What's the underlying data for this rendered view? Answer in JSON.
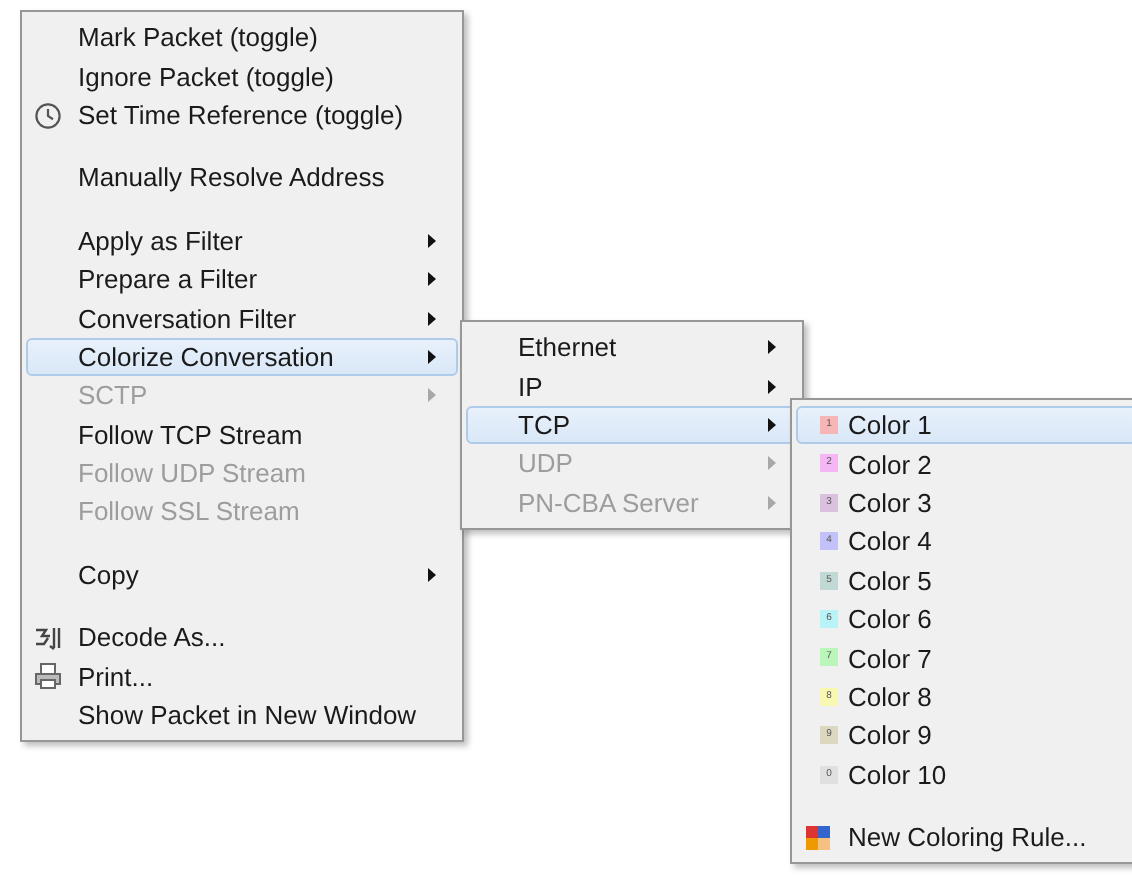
{
  "menus": [
    {
      "items": [
        {
          "kind": "text",
          "label": "Mark Packet (toggle)",
          "disabled": false,
          "selected": false
        },
        {
          "kind": "text",
          "label": "Ignore Packet (toggle)",
          "disabled": false,
          "selected": false
        },
        {
          "kind": "icon",
          "label": "Set Time Reference (toggle)",
          "disabled": false,
          "selected": false
        },
        {
          "kind": "separator"
        },
        {
          "kind": "text",
          "label": "Manually Resolve Address",
          "disabled": false,
          "selected": false
        },
        {
          "kind": "separator"
        },
        {
          "kind": "submenu",
          "label": "Apply as Filter",
          "disabled": false,
          "selected": false
        },
        {
          "kind": "submenu",
          "label": "Prepare a Filter",
          "disabled": false,
          "selected": false
        },
        {
          "kind": "submenu",
          "label": "Conversation Filter",
          "disabled": false,
          "selected": false
        },
        {
          "kind": "submenu",
          "label": "Colorize Conversation",
          "disabled": false,
          "selected": true
        },
        {
          "kind": "submenu",
          "label": "SCTP",
          "disabled": true,
          "selected": false
        },
        {
          "kind": "text",
          "label": "Follow TCP Stream",
          "disabled": false,
          "selected": false
        },
        {
          "kind": "text",
          "label": "Follow UDP Stream",
          "disabled": true,
          "selected": false
        },
        {
          "kind": "text",
          "label": "Follow SSL Stream",
          "disabled": true,
          "selected": false
        },
        {
          "kind": "separator"
        },
        {
          "kind": "submenu",
          "label": "Copy",
          "disabled": false,
          "selected": false
        },
        {
          "kind": "separator"
        },
        {
          "kind": "icon",
          "label": "Decode As...",
          "disabled": false,
          "selected": false
        },
        {
          "kind": "icon",
          "label": "Print...",
          "disabled": false,
          "selected": false
        },
        {
          "kind": "text",
          "label": "Show Packet in New Window",
          "disabled": false,
          "selected": false
        }
      ]
    },
    {
      "items": [
        {
          "kind": "submenu",
          "label": "Ethernet",
          "disabled": false,
          "selected": false
        },
        {
          "kind": "submenu",
          "label": "IP",
          "disabled": false,
          "selected": false
        },
        {
          "kind": "submenu",
          "label": "TCP",
          "disabled": false,
          "selected": true
        },
        {
          "kind": "submenu",
          "label": "UDP",
          "disabled": true,
          "selected": false
        },
        {
          "kind": "submenu",
          "label": "PN-CBA Server",
          "disabled": true,
          "selected": false
        }
      ]
    },
    {
      "items": [
        {
          "kind": "swatch",
          "label": "Color 1",
          "swatch": "1",
          "color": "#f6b6b6",
          "disabled": false,
          "selected": true
        },
        {
          "kind": "swatch",
          "label": "Color 2",
          "swatch": "2",
          "color": "#f5b6f5",
          "disabled": false,
          "selected": false
        },
        {
          "kind": "swatch",
          "label": "Color 3",
          "swatch": "3",
          "color": "#dac2df",
          "disabled": false,
          "selected": false
        },
        {
          "kind": "swatch",
          "label": "Color 4",
          "swatch": "4",
          "color": "#c2c2f8",
          "disabled": false,
          "selected": false
        },
        {
          "kind": "swatch",
          "label": "Color 5",
          "swatch": "5",
          "color": "#c0d9d4",
          "disabled": false,
          "selected": false
        },
        {
          "kind": "swatch",
          "label": "Color 6",
          "swatch": "6",
          "color": "#b8f3f8",
          "disabled": false,
          "selected": false
        },
        {
          "kind": "swatch",
          "label": "Color 7",
          "swatch": "7",
          "color": "#baf5ba",
          "disabled": false,
          "selected": false
        },
        {
          "kind": "swatch",
          "label": "Color 8",
          "swatch": "8",
          "color": "#f8f8b2",
          "disabled": false,
          "selected": false
        },
        {
          "kind": "swatch",
          "label": "Color 9",
          "swatch": "9",
          "color": "#dcd8c0",
          "disabled": false,
          "selected": false
        },
        {
          "kind": "swatch",
          "label": "Color 10",
          "swatch": "0",
          "color": "#e0e0e0",
          "disabled": false,
          "selected": false
        },
        {
          "kind": "separator"
        },
        {
          "kind": "icon",
          "label": "New Coloring Rule...",
          "disabled": false,
          "selected": false
        }
      ]
    }
  ]
}
